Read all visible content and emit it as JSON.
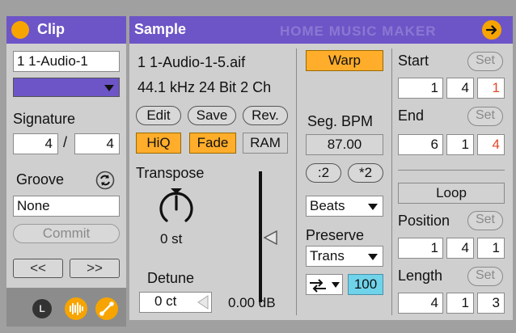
{
  "clip": {
    "title": "Clip",
    "name": "1 1-Audio-1",
    "color": "#6d55c7",
    "signature_label": "Signature",
    "sig_numerator": "4",
    "sig_separator": "/",
    "sig_denominator": "4",
    "groove_label": "Groove",
    "groove_value": "None",
    "commit_label": "Commit",
    "nudge_back_label": "<<",
    "nudge_fwd_label": ">>"
  },
  "bottom_bar": {
    "left_badge": "L"
  },
  "sample": {
    "title": "Sample",
    "watermark": "HOME MUSIC MAKER",
    "file_name": "1 1-Audio-1-5.aif",
    "file_info": "44.1 kHz 24 Bit 2 Ch",
    "edit_label": "Edit",
    "save_label": "Save",
    "rev_label": "Rev.",
    "hiq_label": "HiQ",
    "fade_label": "Fade",
    "ram_label": "RAM",
    "transpose_label": "Transpose",
    "transpose_value": "0 st",
    "detune_label": "Detune",
    "detune_value": "0 ct",
    "gain_value": "0.00 dB"
  },
  "warp": {
    "warp_label": "Warp",
    "seg_bpm_label": "Seg. BPM",
    "seg_bpm_value": "87.00",
    "half_label": ":2",
    "double_label": "*2",
    "mode_value": "Beats",
    "preserve_label": "Preserve",
    "preserve_value": "Trans",
    "envelope_value": "100"
  },
  "markers": {
    "start_label": "Start",
    "start": [
      "1",
      "4",
      "1"
    ],
    "end_label": "End",
    "end": [
      "6",
      "1",
      "4"
    ],
    "set_label": "Set",
    "loop_label": "Loop",
    "position_label": "Position",
    "position": [
      "1",
      "4",
      "1"
    ],
    "length_label": "Length",
    "length": [
      "4",
      "1",
      "3"
    ]
  }
}
